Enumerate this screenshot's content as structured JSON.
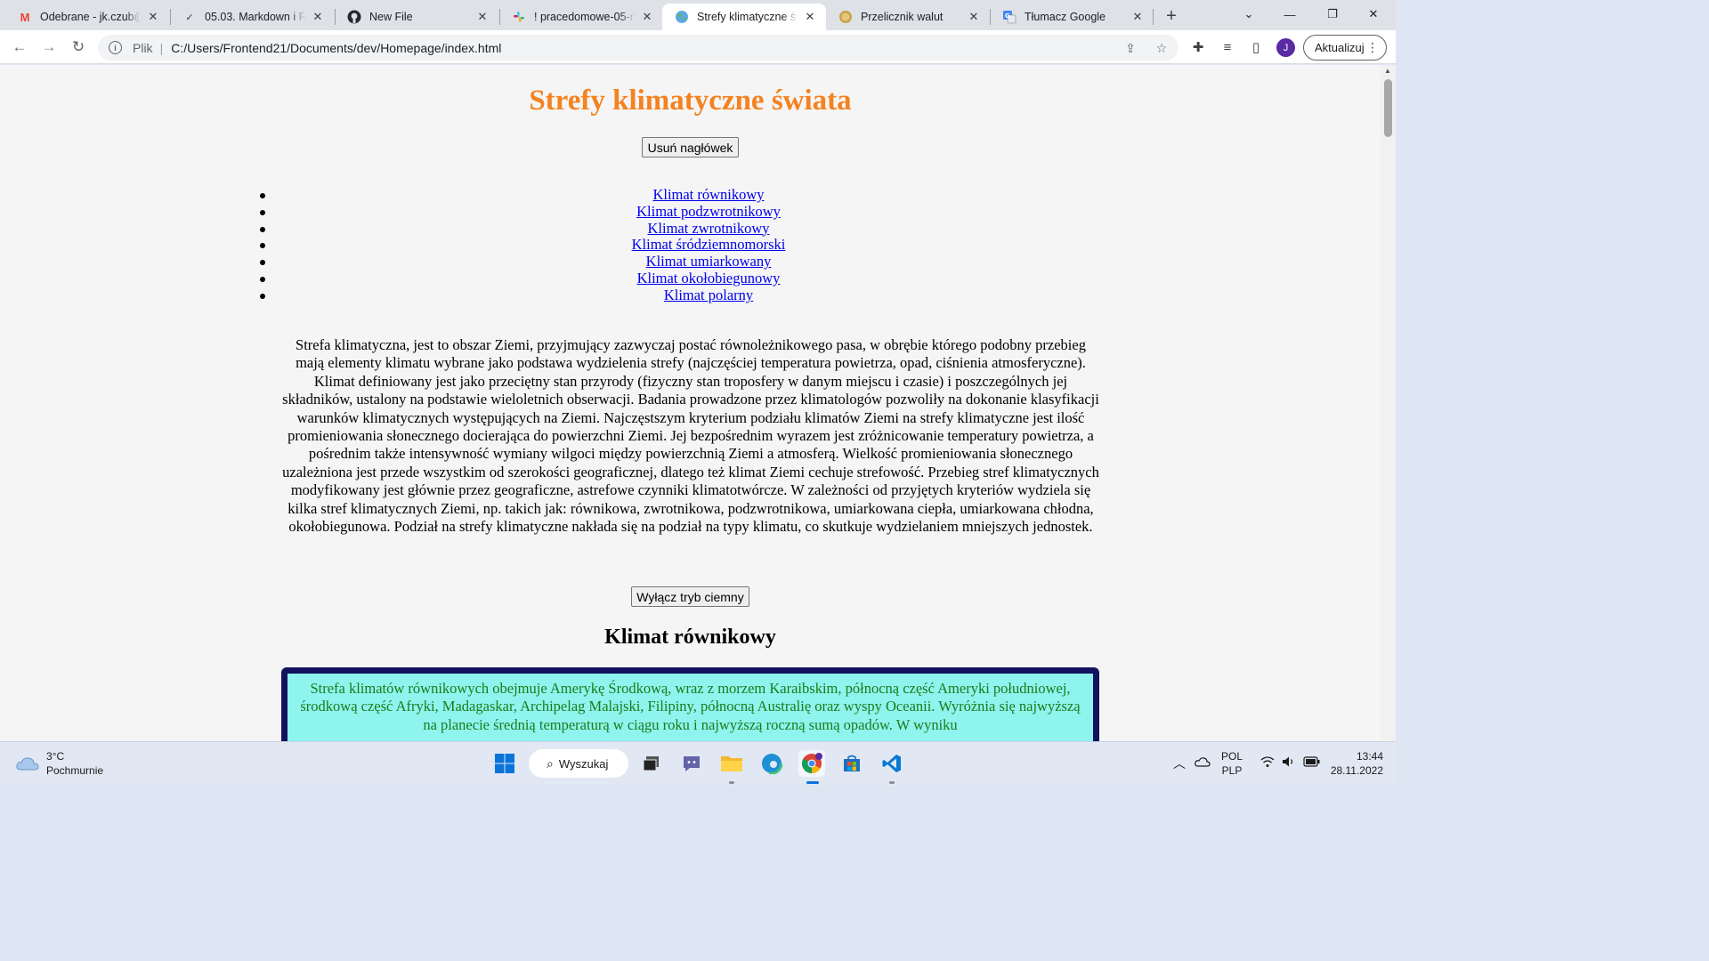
{
  "browser": {
    "tabs": [
      {
        "title": "Odebrane - jk.czub@s",
        "favicon": "gmail-icon",
        "active": false
      },
      {
        "title": "05.03. Markdown i README",
        "favicon": "notion-icon",
        "active": false
      },
      {
        "title": "New File",
        "favicon": "github-icon",
        "active": false
      },
      {
        "title": "! pracedomowe-05-m",
        "favicon": "slack-icon",
        "active": false
      },
      {
        "title": "Strefy klimatyczne świata",
        "favicon": "globe-icon",
        "active": true
      },
      {
        "title": "Przelicznik walut",
        "favicon": "coin-icon",
        "active": false
      },
      {
        "title": "Tłumacz Google",
        "favicon": "google-translate-icon",
        "active": false
      }
    ],
    "address": {
      "scheme": "Plik",
      "url": "C:/Users/Frontend21/Documents/dev/Homepage/index.html"
    },
    "update_label": "Aktualizuj",
    "profile_initial": "J"
  },
  "page": {
    "title": "Strefy klimatyczne świata",
    "remove_header_button": "Usuń nagłówek",
    "nav": [
      "Klimat równikowy",
      "Klimat podzwrotnikowy",
      "Klimat zwrotnikowy",
      "Klimat śródziemnomorski",
      "Klimat umiarkowany",
      "Klimat okołobiegunowy",
      "Klimat polarny"
    ],
    "intro": "Strefa klimatyczna, jest to obszar Ziemi, przyjmujący zazwyczaj postać równoleżnikowego pasa, w obrębie którego podobny przebieg mają elementy klimatu wybrane jako podstawa wydzielenia strefy (najczęściej temperatura powietrza, opad, ciśnienia atmosferyczne). Klimat definiowany jest jako przeciętny stan przyrody (fizyczny stan troposfery w danym miejscu i czasie) i poszczególnych jej składników, ustalony na podstawie wieloletnich obserwacji. Badania prowadzone przez klimatologów pozwoliły na dokonanie klasyfikacji warunków klimatycznych występujących na Ziemi. Najczęstszym kryterium podziału klimatów Ziemi na strefy klimatyczne jest ilość promieniowania słonecznego docierająca do powierzchni Ziemi. Jej bezpośrednim wyrazem jest zróżnicowanie temperatury powietrza, a pośrednim także intensywność wymiany wilgoci między powierzchnią Ziemi a atmosferą. Wielkość promieniowania słonecznego uzależniona jest przede wszystkim od szerokości geograficznej, dlatego też klimat Ziemi cechuje strefowość. Przebieg stref klimatycznych modyfikowany jest głównie przez geograficzne, astrefowe czynniki klimatotwórcze. W zależności od przyjętych kryteriów wydziela się kilka stref klimatycznych Ziemi, np. takich jak: równikowa, zwrotnikowa, podzwrotnikowa, umiarkowana ciepła, umiarkowana chłodna, okołobiegunowa. Podział na strefy klimatyczne nakłada się na podział na typy klimatu, co skutkuje wydzielaniem mniejszych jednostek.",
    "dark_mode_button": "Wyłącz tryb ciemny",
    "section_heading": "Klimat równikowy",
    "section_text": "Strefa klimatów równikowych obejmuje Amerykę Środkową, wraz z morzem Karaibskim, północną część Ameryki południowej, środkową część Afryki, Madagaskar, Archipelag Malajski, Filipiny, północną Australię oraz wyspy Oceanii. Wyróżnia się najwyższą na planecie średnią temperaturą w ciągu roku i najwyższą roczną sumą opadów. W wyniku"
  },
  "taskbar": {
    "weather_temp": "3°C",
    "weather_desc": "Pochmurnie",
    "search_label": "Wyszukaj",
    "lang_top": "POL",
    "lang_bottom": "PLP",
    "time": "13:44",
    "date": "28.11.2022"
  },
  "colors": {
    "title": "#f58220",
    "link": "#0000ee",
    "section_bg": "#8ff4ee",
    "section_border": "#12125e",
    "section_text": "#1a7c1a"
  }
}
